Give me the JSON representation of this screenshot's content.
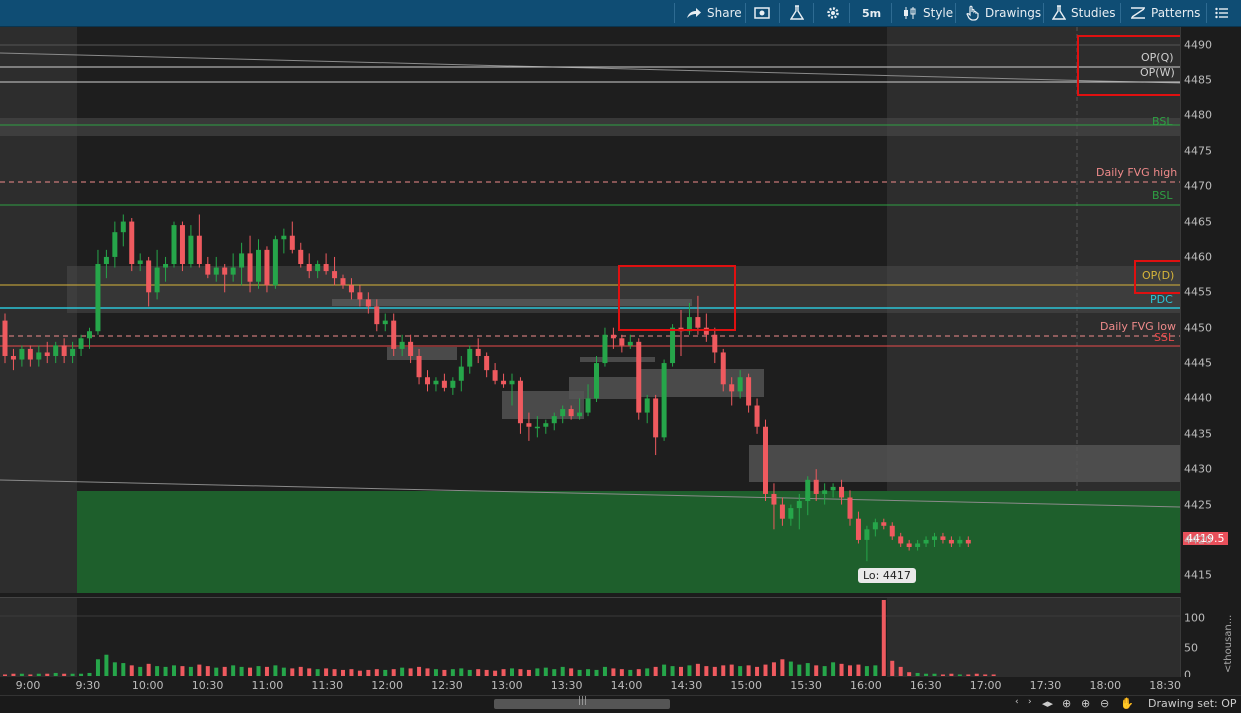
{
  "toolbar": {
    "share": "Share",
    "timeframe": "5m",
    "style": "Style",
    "drawings": "Drawings",
    "studies": "Studies",
    "patterns": "Patterns"
  },
  "yaxis": {
    "ticks": [
      "4490",
      "4485",
      "4480",
      "4475",
      "4470",
      "4465",
      "4460",
      "4455",
      "4450",
      "4445",
      "4440",
      "4435",
      "4430",
      "4425",
      "4420",
      "4415"
    ]
  },
  "levels": {
    "op_q": "OP(Q)",
    "op_w": "OP(W)",
    "bsl_upper": "BSL",
    "fvg_high": "Daily FVG high",
    "bsl_lower": "BSL",
    "op_d": "OP(D)",
    "pdc": "PDC",
    "fvg_low": "Daily FVG low",
    "ssl": "SSL"
  },
  "colors": {
    "bull": "#26a64a",
    "bear": "#ef5a5f",
    "toolbar": "#0f4d74",
    "bsl": "#2ea043",
    "fvg": "#ee8a8a",
    "op_d": "#d6b43a",
    "pdc": "#2bc4d6",
    "ssl": "#e84a4a"
  },
  "last_price": "4419.5",
  "low_label": "Lo: 4417",
  "volume_axis": {
    "ticks": [
      "100",
      "50",
      "0"
    ],
    "unit": "<thousan..."
  },
  "xaxis": {
    "ticks": [
      "9:00",
      "9:30",
      "10:00",
      "10:30",
      "11:00",
      "11:30",
      "12:00",
      "12:30",
      "13:00",
      "13:30",
      "14:00",
      "14:30",
      "15:00",
      "15:30",
      "16:00",
      "16:30",
      "17:00",
      "17:30",
      "18:00",
      "18:30"
    ]
  },
  "status": {
    "drawing_set": "Drawing set: OP"
  },
  "chart_data": {
    "type": "candlestick",
    "ylim": [
      4412.5,
      4492.5
    ],
    "candles": [
      {
        "o": 4451.0,
        "h": 4452.0,
        "l": 4445.0,
        "c": 4446.0
      },
      {
        "o": 4446.0,
        "h": 4447.0,
        "l": 4444.0,
        "c": 4445.5
      },
      {
        "o": 4445.5,
        "h": 4447.5,
        "l": 4444.5,
        "c": 4447.0
      },
      {
        "o": 4447.0,
        "h": 4447.5,
        "l": 4444.5,
        "c": 4445.5
      },
      {
        "o": 4445.5,
        "h": 4447.5,
        "l": 4444.5,
        "c": 4446.5
      },
      {
        "o": 4446.5,
        "h": 4448.0,
        "l": 4445.0,
        "c": 4446.0
      },
      {
        "o": 4446.0,
        "h": 4448.0,
        "l": 4445.0,
        "c": 4447.5
      },
      {
        "o": 4447.5,
        "h": 4448.5,
        "l": 4445.0,
        "c": 4446.0
      },
      {
        "o": 4446.0,
        "h": 4448.0,
        "l": 4445.0,
        "c": 4447.0
      },
      {
        "o": 4447.0,
        "h": 4449.0,
        "l": 4446.0,
        "c": 4448.5
      },
      {
        "o": 4448.5,
        "h": 4450.0,
        "l": 4447.0,
        "c": 4449.5
      },
      {
        "o": 4449.5,
        "h": 4461.0,
        "l": 4449.0,
        "c": 4459.0
      },
      {
        "o": 4459.0,
        "h": 4461.0,
        "l": 4457.0,
        "c": 4460.0
      },
      {
        "o": 4460.0,
        "h": 4465.0,
        "l": 4458.5,
        "c": 4463.5
      },
      {
        "o": 4463.5,
        "h": 4466.0,
        "l": 4461.5,
        "c": 4465.0
      },
      {
        "o": 4465.0,
        "h": 4465.5,
        "l": 4458.0,
        "c": 4459.0
      },
      {
        "o": 4459.0,
        "h": 4460.5,
        "l": 4458.0,
        "c": 4459.5
      },
      {
        "o": 4459.5,
        "h": 4460.0,
        "l": 4453.0,
        "c": 4455.0
      },
      {
        "o": 4455.0,
        "h": 4461.0,
        "l": 4454.0,
        "c": 4458.5
      },
      {
        "o": 4458.5,
        "h": 4460.0,
        "l": 4456.5,
        "c": 4459.0
      },
      {
        "o": 4459.0,
        "h": 4465.0,
        "l": 4458.5,
        "c": 4464.5
      },
      {
        "o": 4464.5,
        "h": 4465.0,
        "l": 4458.0,
        "c": 4459.0
      },
      {
        "o": 4459.0,
        "h": 4464.5,
        "l": 4458.5,
        "c": 4463.0
      },
      {
        "o": 4463.0,
        "h": 4466.0,
        "l": 4458.5,
        "c": 4459.0
      },
      {
        "o": 4459.0,
        "h": 4460.0,
        "l": 4457.0,
        "c": 4457.5
      },
      {
        "o": 4457.5,
        "h": 4460.0,
        "l": 4456.5,
        "c": 4458.5
      },
      {
        "o": 4458.5,
        "h": 4459.0,
        "l": 4455.0,
        "c": 4457.5
      },
      {
        "o": 4457.5,
        "h": 4460.5,
        "l": 4456.5,
        "c": 4458.5
      },
      {
        "o": 4458.5,
        "h": 4462.0,
        "l": 4456.0,
        "c": 4460.5
      },
      {
        "o": 4460.5,
        "h": 4463.0,
        "l": 4455.0,
        "c": 4456.5
      },
      {
        "o": 4456.5,
        "h": 4462.5,
        "l": 4455.5,
        "c": 4461.0
      },
      {
        "o": 4461.0,
        "h": 4461.5,
        "l": 4455.0,
        "c": 4456.0
      },
      {
        "o": 4456.0,
        "h": 4463.0,
        "l": 4455.5,
        "c": 4462.5
      },
      {
        "o": 4462.5,
        "h": 4464.0,
        "l": 4460.5,
        "c": 4463.0
      },
      {
        "o": 4463.0,
        "h": 4465.0,
        "l": 4460.5,
        "c": 4461.0
      },
      {
        "o": 4461.0,
        "h": 4462.0,
        "l": 4458.5,
        "c": 4459.0
      },
      {
        "o": 4459.0,
        "h": 4460.5,
        "l": 4457.0,
        "c": 4458.0
      },
      {
        "o": 4458.0,
        "h": 4459.5,
        "l": 4457.0,
        "c": 4459.0
      },
      {
        "o": 4459.0,
        "h": 4460.5,
        "l": 4457.5,
        "c": 4458.0
      },
      {
        "o": 4458.0,
        "h": 4460.0,
        "l": 4456.0,
        "c": 4457.0
      },
      {
        "o": 4457.0,
        "h": 4457.5,
        "l": 4455.5,
        "c": 4456.0
      },
      {
        "o": 4456.0,
        "h": 4457.0,
        "l": 4454.0,
        "c": 4455.0
      },
      {
        "o": 4455.0,
        "h": 4456.0,
        "l": 4453.0,
        "c": 4454.0
      },
      {
        "o": 4454.0,
        "h": 4455.0,
        "l": 4452.0,
        "c": 4453.0
      },
      {
        "o": 4453.0,
        "h": 4454.0,
        "l": 4449.5,
        "c": 4450.5
      },
      {
        "o": 4450.5,
        "h": 4452.0,
        "l": 4449.5,
        "c": 4451.0
      },
      {
        "o": 4451.0,
        "h": 4452.0,
        "l": 4446.0,
        "c": 4447.0
      },
      {
        "o": 4447.0,
        "h": 4449.0,
        "l": 4446.0,
        "c": 4448.0
      },
      {
        "o": 4448.0,
        "h": 4449.0,
        "l": 4445.0,
        "c": 4446.0
      },
      {
        "o": 4446.0,
        "h": 4447.0,
        "l": 4442.0,
        "c": 4443.0
      },
      {
        "o": 4443.0,
        "h": 4444.0,
        "l": 4441.0,
        "c": 4442.0
      },
      {
        "o": 4442.0,
        "h": 4443.0,
        "l": 4441.0,
        "c": 4442.5
      },
      {
        "o": 4442.5,
        "h": 4443.5,
        "l": 4441.0,
        "c": 4441.5
      },
      {
        "o": 4441.5,
        "h": 4443.0,
        "l": 4440.5,
        "c": 4442.5
      },
      {
        "o": 4442.5,
        "h": 4446.0,
        "l": 4441.0,
        "c": 4444.5
      },
      {
        "o": 4444.5,
        "h": 4447.5,
        "l": 4443.5,
        "c": 4447.0
      },
      {
        "o": 4447.0,
        "h": 4448.5,
        "l": 4445.0,
        "c": 4446.0
      },
      {
        "o": 4446.0,
        "h": 4446.5,
        "l": 4443.0,
        "c": 4444.0
      },
      {
        "o": 4444.0,
        "h": 4445.0,
        "l": 4442.0,
        "c": 4442.5
      },
      {
        "o": 4442.5,
        "h": 4443.5,
        "l": 4441.5,
        "c": 4442.0
      },
      {
        "o": 4442.0,
        "h": 4443.5,
        "l": 4439.0,
        "c": 4442.5
      },
      {
        "o": 4442.5,
        "h": 4443.0,
        "l": 4435.0,
        "c": 4436.5
      },
      {
        "o": 4436.5,
        "h": 4438.0,
        "l": 4434.0,
        "c": 4436.0
      },
      {
        "o": 4436.0,
        "h": 4437.5,
        "l": 4434.5,
        "c": 4436.0
      },
      {
        "o": 4436.0,
        "h": 4437.0,
        "l": 4435.0,
        "c": 4436.5
      },
      {
        "o": 4436.5,
        "h": 4438.0,
        "l": 4435.5,
        "c": 4437.5
      },
      {
        "o": 4437.5,
        "h": 4439.0,
        "l": 4436.5,
        "c": 4438.5
      },
      {
        "o": 4438.5,
        "h": 4439.0,
        "l": 4437.0,
        "c": 4437.5
      },
      {
        "o": 4437.5,
        "h": 4440.0,
        "l": 4437.0,
        "c": 4438.0
      },
      {
        "o": 4438.0,
        "h": 4442.0,
        "l": 4437.5,
        "c": 4440.0
      },
      {
        "o": 4440.0,
        "h": 4446.0,
        "l": 4439.5,
        "c": 4445.0
      },
      {
        "o": 4445.0,
        "h": 4450.0,
        "l": 4444.5,
        "c": 4449.0
      },
      {
        "o": 4449.0,
        "h": 4450.0,
        "l": 4447.0,
        "c": 4448.5
      },
      {
        "o": 4448.5,
        "h": 4449.0,
        "l": 4446.5,
        "c": 4447.5
      },
      {
        "o": 4447.5,
        "h": 4449.0,
        "l": 4447.0,
        "c": 4448.0
      },
      {
        "o": 4448.0,
        "h": 4448.5,
        "l": 4437.0,
        "c": 4438.0
      },
      {
        "o": 4438.0,
        "h": 4440.5,
        "l": 4436.5,
        "c": 4440.0
      },
      {
        "o": 4440.0,
        "h": 4440.5,
        "l": 4432.0,
        "c": 4434.5
      },
      {
        "o": 4434.5,
        "h": 4445.5,
        "l": 4434.0,
        "c": 4445.0
      },
      {
        "o": 4445.0,
        "h": 4450.5,
        "l": 4444.5,
        "c": 4450.0
      },
      {
        "o": 4450.0,
        "h": 4452.5,
        "l": 4446.0,
        "c": 4449.5
      },
      {
        "o": 4449.5,
        "h": 4453.5,
        "l": 4449.0,
        "c": 4451.5
      },
      {
        "o": 4451.5,
        "h": 4454.5,
        "l": 4449.0,
        "c": 4450.0
      },
      {
        "o": 4450.0,
        "h": 4452.0,
        "l": 4448.0,
        "c": 4449.0
      },
      {
        "o": 4449.0,
        "h": 4450.0,
        "l": 4445.0,
        "c": 4446.5
      },
      {
        "o": 4446.5,
        "h": 4447.0,
        "l": 4441.0,
        "c": 4442.0
      },
      {
        "o": 4442.0,
        "h": 4443.0,
        "l": 4439.0,
        "c": 4441.0
      },
      {
        "o": 4441.0,
        "h": 4444.0,
        "l": 4440.0,
        "c": 4443.0
      },
      {
        "o": 4443.0,
        "h": 4443.5,
        "l": 4438.0,
        "c": 4439.0
      },
      {
        "o": 4439.0,
        "h": 4440.0,
        "l": 4435.0,
        "c": 4436.0
      },
      {
        "o": 4436.0,
        "h": 4437.0,
        "l": 4425.5,
        "c": 4426.5
      },
      {
        "o": 4426.5,
        "h": 4428.0,
        "l": 4421.5,
        "c": 4425.0
      },
      {
        "o": 4425.0,
        "h": 4426.0,
        "l": 4422.0,
        "c": 4423.0
      },
      {
        "o": 4423.0,
        "h": 4425.0,
        "l": 4422.0,
        "c": 4424.5
      },
      {
        "o": 4424.5,
        "h": 4426.5,
        "l": 4421.5,
        "c": 4425.5
      },
      {
        "o": 4425.5,
        "h": 4429.0,
        "l": 4423.5,
        "c": 4428.5
      },
      {
        "o": 4428.5,
        "h": 4430.0,
        "l": 4425.5,
        "c": 4426.5
      },
      {
        "o": 4426.5,
        "h": 4428.0,
        "l": 4425.0,
        "c": 4427.0
      },
      {
        "o": 4427.0,
        "h": 4428.0,
        "l": 4426.0,
        "c": 4427.5
      },
      {
        "o": 4427.5,
        "h": 4428.5,
        "l": 4425.0,
        "c": 4426.0
      },
      {
        "o": 4426.0,
        "h": 4427.0,
        "l": 4422.0,
        "c": 4423.0
      },
      {
        "o": 4423.0,
        "h": 4424.0,
        "l": 4419.5,
        "c": 4420.0
      },
      {
        "o": 4420.0,
        "h": 4422.0,
        "l": 4417.0,
        "c": 4421.5
      },
      {
        "o": 4421.5,
        "h": 4423.0,
        "l": 4420.5,
        "c": 4422.5
      },
      {
        "o": 4422.5,
        "h": 4423.0,
        "l": 4421.5,
        "c": 4422.0
      },
      {
        "o": 4422.0,
        "h": 4422.5,
        "l": 4420.0,
        "c": 4420.5
      },
      {
        "o": 4420.5,
        "h": 4421.0,
        "l": 4419.0,
        "c": 4419.5
      },
      {
        "o": 4419.5,
        "h": 4420.0,
        "l": 4418.5,
        "c": 4419.0
      },
      {
        "o": 4419.0,
        "h": 4420.0,
        "l": 4418.5,
        "c": 4419.5
      },
      {
        "o": 4419.5,
        "h": 4420.5,
        "l": 4419.0,
        "c": 4420.0
      },
      {
        "o": 4420.0,
        "h": 4421.0,
        "l": 4419.0,
        "c": 4420.5
      },
      {
        "o": 4420.5,
        "h": 4421.0,
        "l": 4419.5,
        "c": 4420.0
      },
      {
        "o": 4420.0,
        "h": 4420.5,
        "l": 4419.0,
        "c": 4419.5
      },
      {
        "o": 4419.5,
        "h": 4420.5,
        "l": 4419.0,
        "c": 4420.0
      },
      {
        "o": 4420.0,
        "h": 4420.5,
        "l": 4419.0,
        "c": 4419.5
      }
    ],
    "volume_ylim": [
      0,
      100
    ],
    "volumes": [
      2,
      3,
      3,
      2,
      3,
      3,
      4,
      3,
      3,
      3,
      4,
      22,
      28,
      18,
      17,
      14,
      12,
      16,
      13,
      12,
      14,
      13,
      12,
      15,
      13,
      11,
      12,
      14,
      12,
      11,
      13,
      12,
      14,
      11,
      10,
      12,
      10,
      9,
      10,
      9,
      8,
      9,
      7,
      8,
      9,
      8,
      9,
      11,
      10,
      12,
      10,
      9,
      8,
      9,
      10,
      8,
      9,
      8,
      7,
      9,
      10,
      9,
      8,
      10,
      11,
      9,
      12,
      10,
      8,
      9,
      8,
      12,
      10,
      9,
      8,
      9,
      10,
      12,
      15,
      13,
      12,
      14,
      16,
      13,
      12,
      14,
      15,
      13,
      14,
      12,
      15,
      18,
      22,
      19,
      15,
      17,
      14,
      13,
      18,
      16,
      14,
      15,
      13,
      14,
      100,
      20,
      12,
      5,
      4,
      3,
      3,
      2,
      3,
      2,
      2,
      3,
      2,
      2
    ]
  }
}
